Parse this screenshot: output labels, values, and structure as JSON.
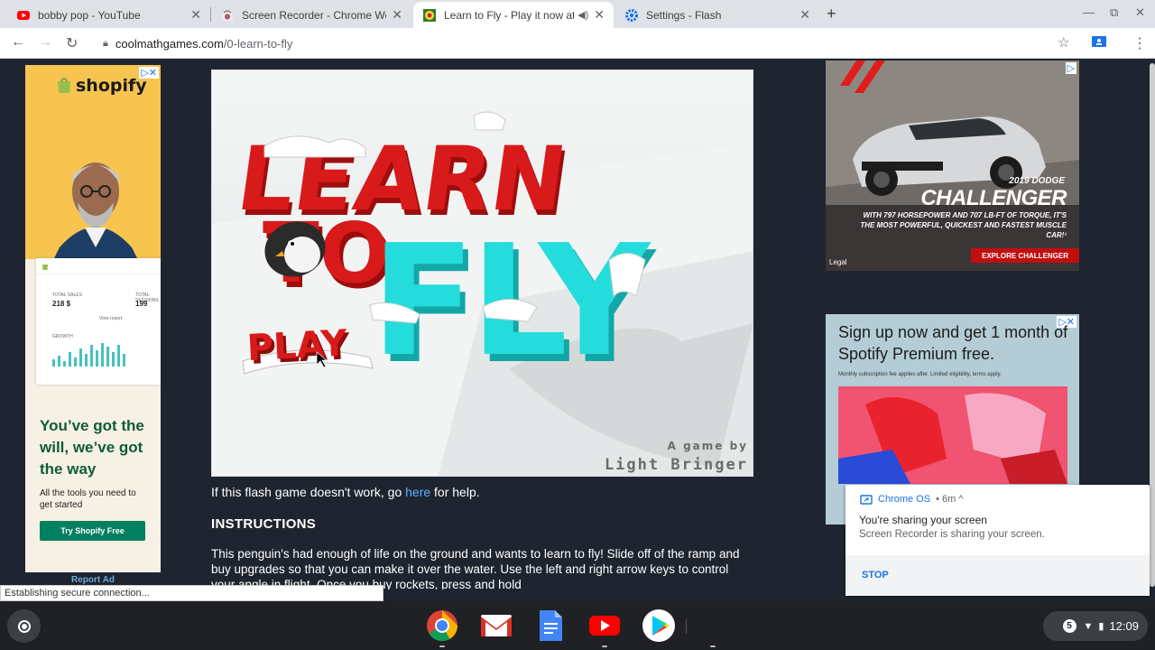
{
  "tabs": [
    {
      "title": "bobby pop - YouTube",
      "icon": "youtube-icon",
      "active": false
    },
    {
      "title": "Screen Recorder - Chrome Web S",
      "icon": "chrome-web-store-icon",
      "active": false
    },
    {
      "title": "Learn to Fly - Play it now at",
      "icon": "coolmath-icon",
      "active": true
    },
    {
      "title": "Settings - Flash",
      "icon": "settings-gear-icon",
      "active": false
    }
  ],
  "address_bar": {
    "host": "coolmathgames.com",
    "path": "/0-learn-to-fly"
  },
  "left_ad": {
    "brand": "shopify",
    "dashboard": {
      "sales_label": "TOTAL SALES",
      "sales_value": "218 $",
      "sessions_label": "TOTAL SESSIONS",
      "sessions_value": "199",
      "growth_label": "GROWTH",
      "view_report": "View report"
    },
    "headline": "You’ve got the will, we’ve got the way",
    "subtext": "All the tools you need to get started",
    "cta": "Try Shopify Free",
    "report": "Report Ad"
  },
  "game": {
    "title_line1": "LEARN",
    "title_line2": "TO",
    "title_fly": "FLY",
    "play_label": "PLAY",
    "credit_line1": "A game by",
    "credit_line2": "Light Bringer"
  },
  "help_text": {
    "before": "If this flash game doesn't work, go ",
    "link": "here",
    "after": " for help."
  },
  "instructions_heading": "INSTRUCTIONS",
  "instructions_text": "This penguin's had enough of life on the ground and wants to learn to fly! Slide off of the ramp and buy upgrades so that you can make it over the water. Use the left and right arrow keys to control your angle in flight. Once you buy rockets, press and hold",
  "car_ad": {
    "year": "2019 DODGE",
    "model": "CHALLENGER",
    "tagline": "WITH 797 HORSEPOWER AND 707 LB-FT OF TORQUE, IT'S THE MOST POWERFUL, QUICKEST AND FASTEST MUSCLE CAR!¹",
    "cta": "EXPLORE CHALLENGER",
    "legal": "Legal"
  },
  "spotify_ad": {
    "headline": "Sign up now and get 1 month of Spotify Premium free.",
    "fine_print": "Monthly subscription fee applies after. Limited eligibility, terms apply."
  },
  "notification": {
    "source": "Chrome OS",
    "age": "• 6m ^",
    "title": "You're sharing your screen",
    "body": "Screen Recorder is sharing your screen.",
    "action": "STOP"
  },
  "status_bar": "Establishing secure connection...",
  "shelf": {
    "apps": [
      "chrome-icon",
      "gmail-icon",
      "google-docs-icon",
      "youtube-icon",
      "play-store-icon"
    ],
    "notification_count": "5",
    "time": "12:09"
  }
}
